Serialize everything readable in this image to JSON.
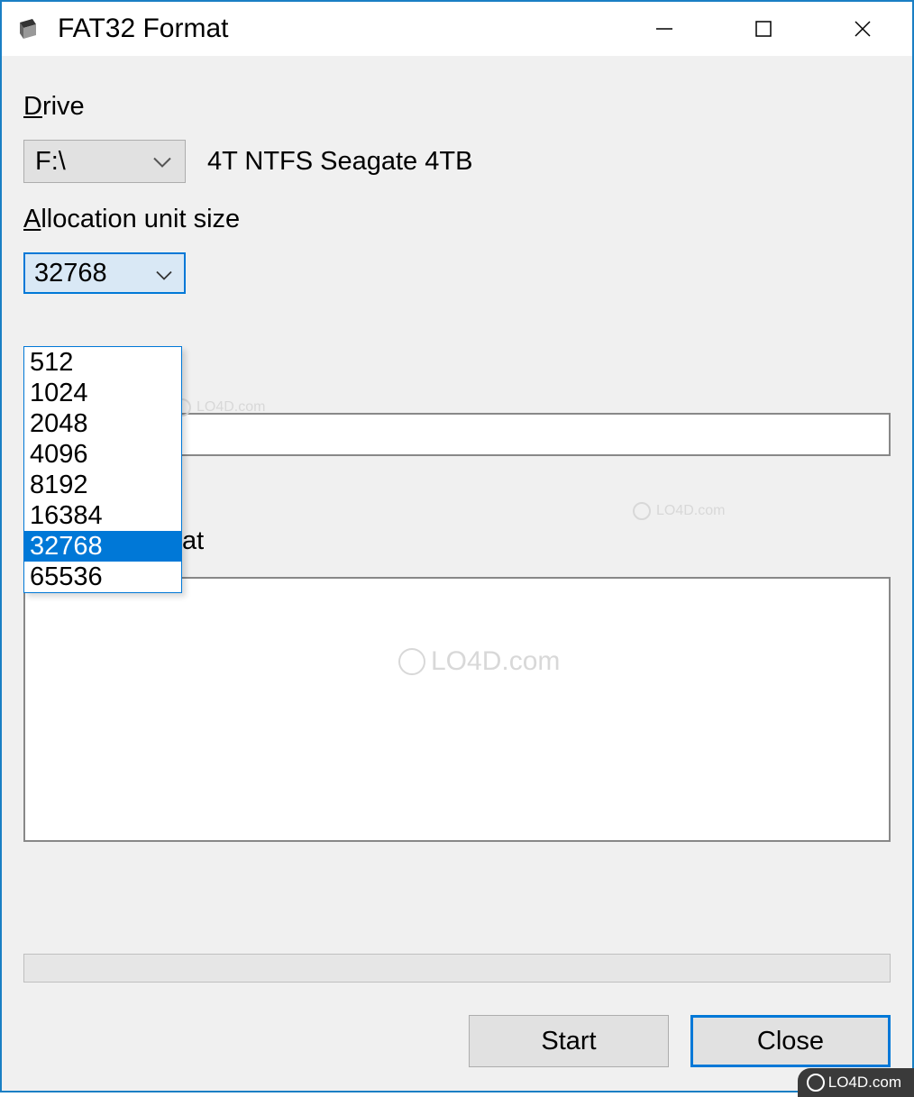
{
  "window": {
    "title": "FAT32 Format"
  },
  "labels": {
    "drive": "Drive",
    "allocation": "Allocation unit size",
    "quick_format_trailing": "at"
  },
  "drive": {
    "selected": "F:\\",
    "description": "4T NTFS Seagate 4TB"
  },
  "allocation": {
    "selected": "32768",
    "options": [
      "512",
      "1024",
      "2048",
      "4096",
      "8192",
      "16384",
      "32768",
      "65536"
    ]
  },
  "buttons": {
    "start": "Start",
    "close": "Close"
  },
  "watermark": "LO4D.com"
}
